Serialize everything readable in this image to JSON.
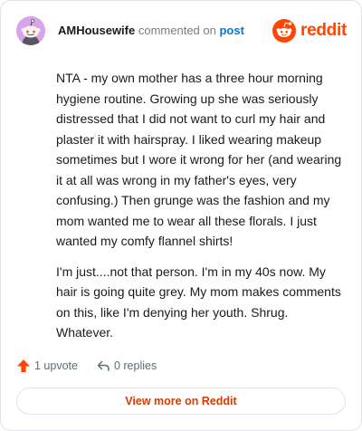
{
  "header": {
    "username": "AMHousewife",
    "action": "commented on",
    "post_link": "post",
    "brand": "reddit"
  },
  "comment": {
    "paragraphs": [
      "NTA - my own mother has a three hour morning hygiene routine. Growing up she was seriously distressed that I did not want to curl my hair and plaster it with hairspray. I liked wearing makeup sometimes but I wore it wrong for her (and wearing it at all was wrong in my father's eyes, very confusing.) Then grunge was the fashion and my mom wanted me to wear all these florals. I just wanted my comfy flannel shirts!",
      "I'm just....not that person. I'm in my 40s now. My hair is going quite grey. My mom makes comments on this, like I'm denying her youth. Shrug. Whatever."
    ]
  },
  "footer": {
    "upvotes": "1 upvote",
    "replies": "0 replies"
  },
  "actions": {
    "view_more": "View more on Reddit"
  },
  "icons": {
    "avatar": "snoo-avatar-icon",
    "brand": "reddit-logo-icon",
    "upvote": "upvote-arrow-icon",
    "reply": "reply-arrow-icon"
  },
  "colors": {
    "brand": "#ff4500",
    "link": "#0079d3",
    "view_more": "#d93a00",
    "muted": "#576f76",
    "avatar_bg": "#d7a6ea",
    "border": "#dfe3e8"
  }
}
